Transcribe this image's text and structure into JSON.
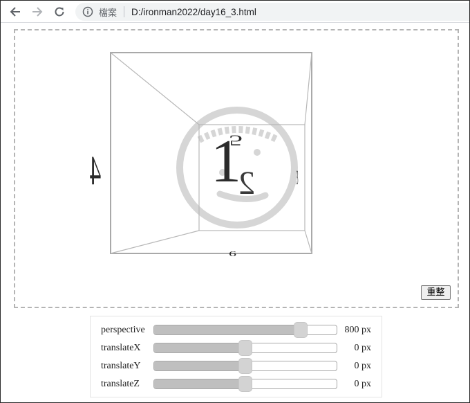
{
  "browser": {
    "back_icon": "arrow-left-icon",
    "forward_icon": "arrow-right-icon",
    "reload_icon": "reload-icon",
    "info_icon": "info-circle-icon",
    "site_label": "檔案",
    "url": "D:/ironman2022/day16_3.html"
  },
  "scene": {
    "faces": [
      {
        "id": "front",
        "label": "1"
      },
      {
        "id": "back",
        "label": "2"
      },
      {
        "id": "top",
        "label": "5"
      },
      {
        "id": "bottom",
        "label": "6"
      },
      {
        "id": "left",
        "label": "4"
      },
      {
        "id": "right",
        "label": "3"
      }
    ],
    "watermark_icon": "smiley-face-watermark",
    "reset_label": "重整"
  },
  "controls": [
    {
      "id": "perspective",
      "label": "perspective",
      "value": "800",
      "unit": "px",
      "fraction": 0.8
    },
    {
      "id": "translateX",
      "label": "translateX",
      "value": "0",
      "unit": "px",
      "fraction": 0.5
    },
    {
      "id": "translateY",
      "label": "translateY",
      "value": "0",
      "unit": "px",
      "fraction": 0.5
    },
    {
      "id": "translateZ",
      "label": "translateZ",
      "value": "0",
      "unit": "px",
      "fraction": 0.5
    }
  ]
}
